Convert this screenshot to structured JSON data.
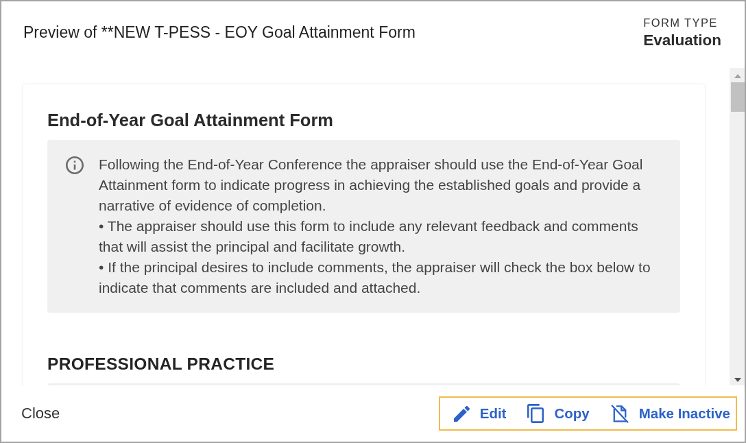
{
  "header": {
    "title": "Preview of **NEW T-PESS - EOY Goal Attainment Form",
    "form_type_label": "FORM TYPE",
    "form_type": "Evaluation"
  },
  "form": {
    "title": "End-of-Year Goal Attainment Form",
    "instructions": [
      "Following the End-of-Year Conference the appraiser should use the End-of-Year Goal Attainment form to indicate progress in achieving the established goals and provide a narrative of evidence of completion.",
      "• The appraiser should use this form to include any relevant feedback and comments that will assist the principal and facilitate growth.",
      "• If the principal desires to include comments, the appraiser will check the box below to indicate that comments are included and attached."
    ],
    "sections": [
      {
        "title": "PROFESSIONAL PRACTICE"
      }
    ]
  },
  "footer": {
    "close": "Close",
    "actions": {
      "highlighted": true,
      "items": [
        {
          "kind": "edit",
          "label": "Edit"
        },
        {
          "kind": "copy",
          "label": "Copy"
        },
        {
          "kind": "deactivate",
          "label": "Make Inactive"
        }
      ]
    }
  }
}
